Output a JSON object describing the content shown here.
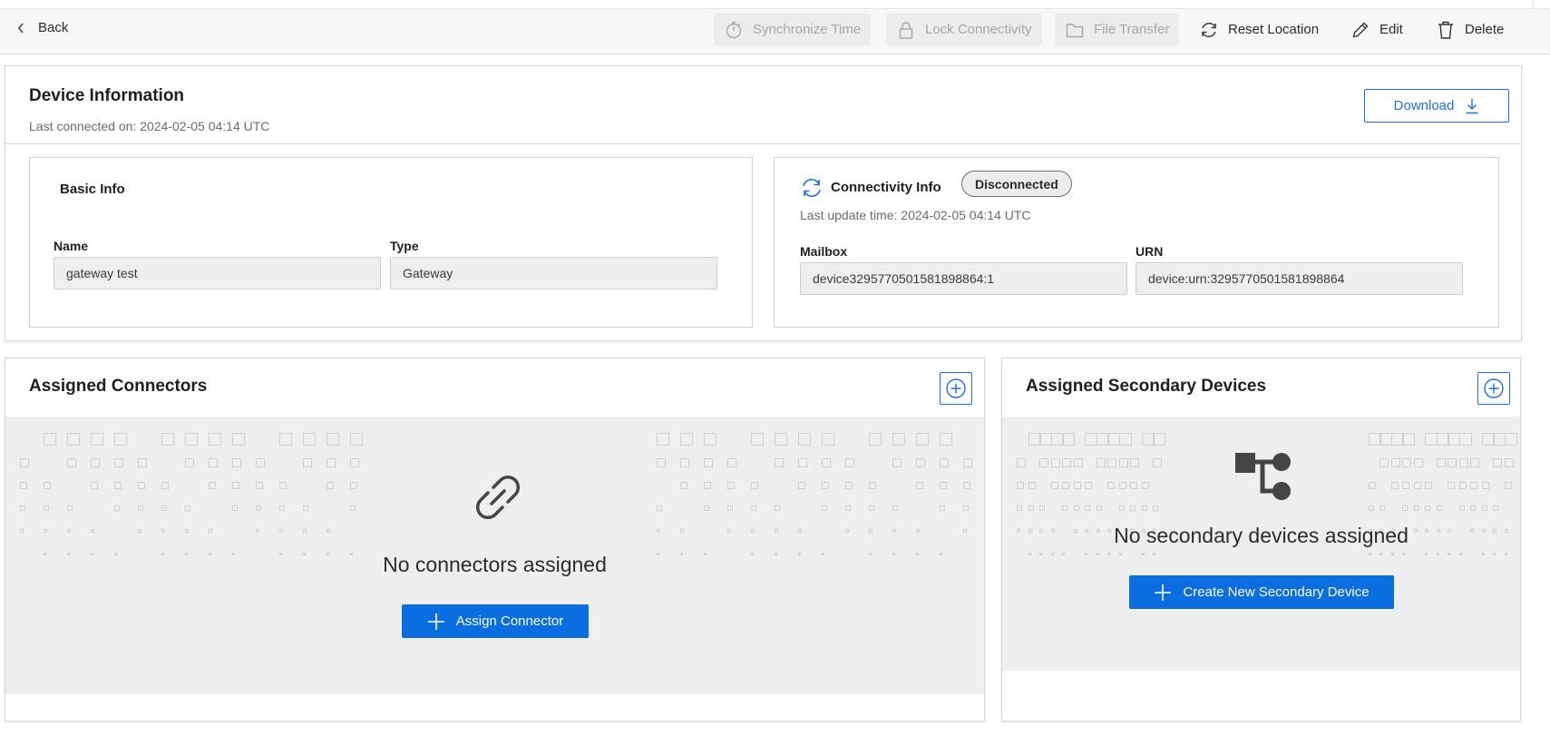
{
  "toolbar": {
    "back_label": "Back",
    "actions": [
      {
        "label": "Synchronize Time",
        "icon": "stopwatch-icon",
        "disabled": true
      },
      {
        "label": "Lock Connectivity",
        "icon": "lock-icon",
        "disabled": true
      },
      {
        "label": "File Transfer",
        "icon": "folder-icon",
        "disabled": true
      },
      {
        "label": "Reset Location",
        "icon": "reset-icon",
        "disabled": false
      },
      {
        "label": "Edit",
        "icon": "pencil-icon",
        "disabled": false
      },
      {
        "label": "Delete",
        "icon": "trash-icon",
        "disabled": false
      }
    ]
  },
  "device_info": {
    "title": "Device Information",
    "last_connected": "Last connected on: 2024-02-05 04:14 UTC",
    "download_label": "Download",
    "basic_info": {
      "title": "Basic Info",
      "name_label": "Name",
      "name_value": "gateway test",
      "type_label": "Type",
      "type_value": "Gateway"
    },
    "connectivity": {
      "title": "Connectivity Info",
      "status": "Disconnected",
      "last_update": "Last update time: 2024-02-05 04:14 UTC",
      "mailbox_label": "Mailbox",
      "mailbox_value": "device3295770501581898864:1",
      "urn_label": "URN",
      "urn_value": "device:urn:3295770501581898864"
    }
  },
  "connectors": {
    "title": "Assigned Connectors",
    "empty_text": "No connectors assigned",
    "button_label": "Assign Connector"
  },
  "secondary_devices": {
    "title": "Assigned Secondary Devices",
    "empty_text": "No secondary devices assigned",
    "button_label": "Create New Secondary Device"
  },
  "colors": {
    "accent": "#0a6ee0",
    "outline_accent": "#1f6fd8",
    "panel_bg": "#eeeeee"
  }
}
